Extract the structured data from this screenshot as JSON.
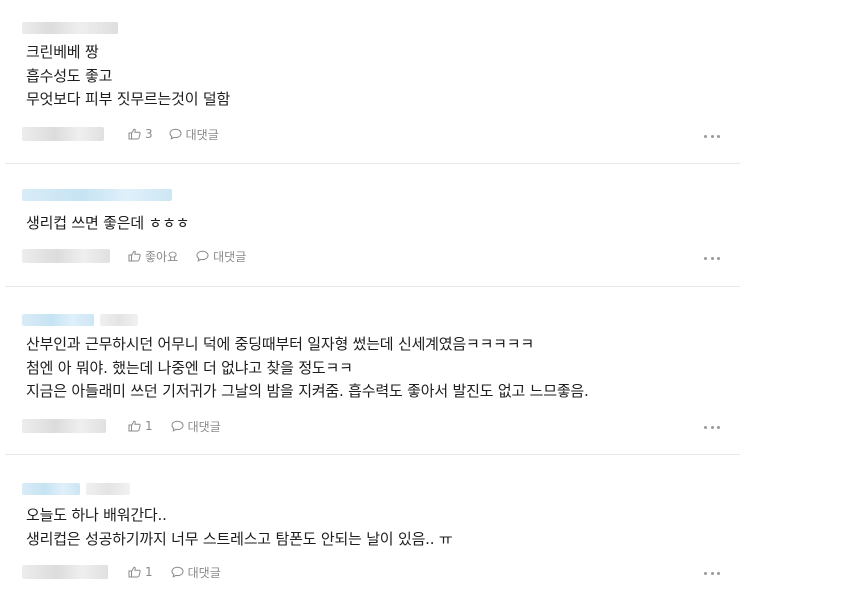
{
  "comments": [
    {
      "lines": [
        "크린베베 짱",
        "흡수성도 좋고",
        "무엇보다 피부 짓무르는것이 덜함"
      ],
      "like_label": "3",
      "reply_label": "대댓글"
    },
    {
      "lines": [
        "생리컵 쓰면 좋은데 ㅎㅎㅎ"
      ],
      "like_label": "좋아요",
      "reply_label": "대댓글"
    },
    {
      "lines": [
        "산부인과 근무하시던 어무니 덕에 중딩때부터 일자형 썼는데 신세계였음ㅋㅋㅋㅋㅋ",
        "첨엔 아 뭐야. 했는데 나중엔 더 없냐고 찾을 정도ㅋㅋ",
        "지금은 아들래미 쓰던 기저귀가 그날의 밤을 지켜줌. 흡수력도 좋아서 발진도 없고 느므좋음."
      ],
      "like_label": "1",
      "reply_label": "대댓글"
    },
    {
      "lines": [
        "오늘도 하나 배워간다..",
        "생리컵은 성공하기까지 너무 스트레스고 탐폰도 안되는 날이 있음.. ㅠ"
      ],
      "like_label": "1",
      "reply_label": "대댓글"
    }
  ],
  "icons": {
    "like": "thumbs-up-icon",
    "reply": "speech-bubble-icon",
    "more": "more-dots-icon"
  },
  "colors": {
    "text": "#1e1e1e",
    "meta": "#8a8a8a",
    "divider": "#e8e8e8",
    "blur_blue": "#c6e3f3"
  }
}
